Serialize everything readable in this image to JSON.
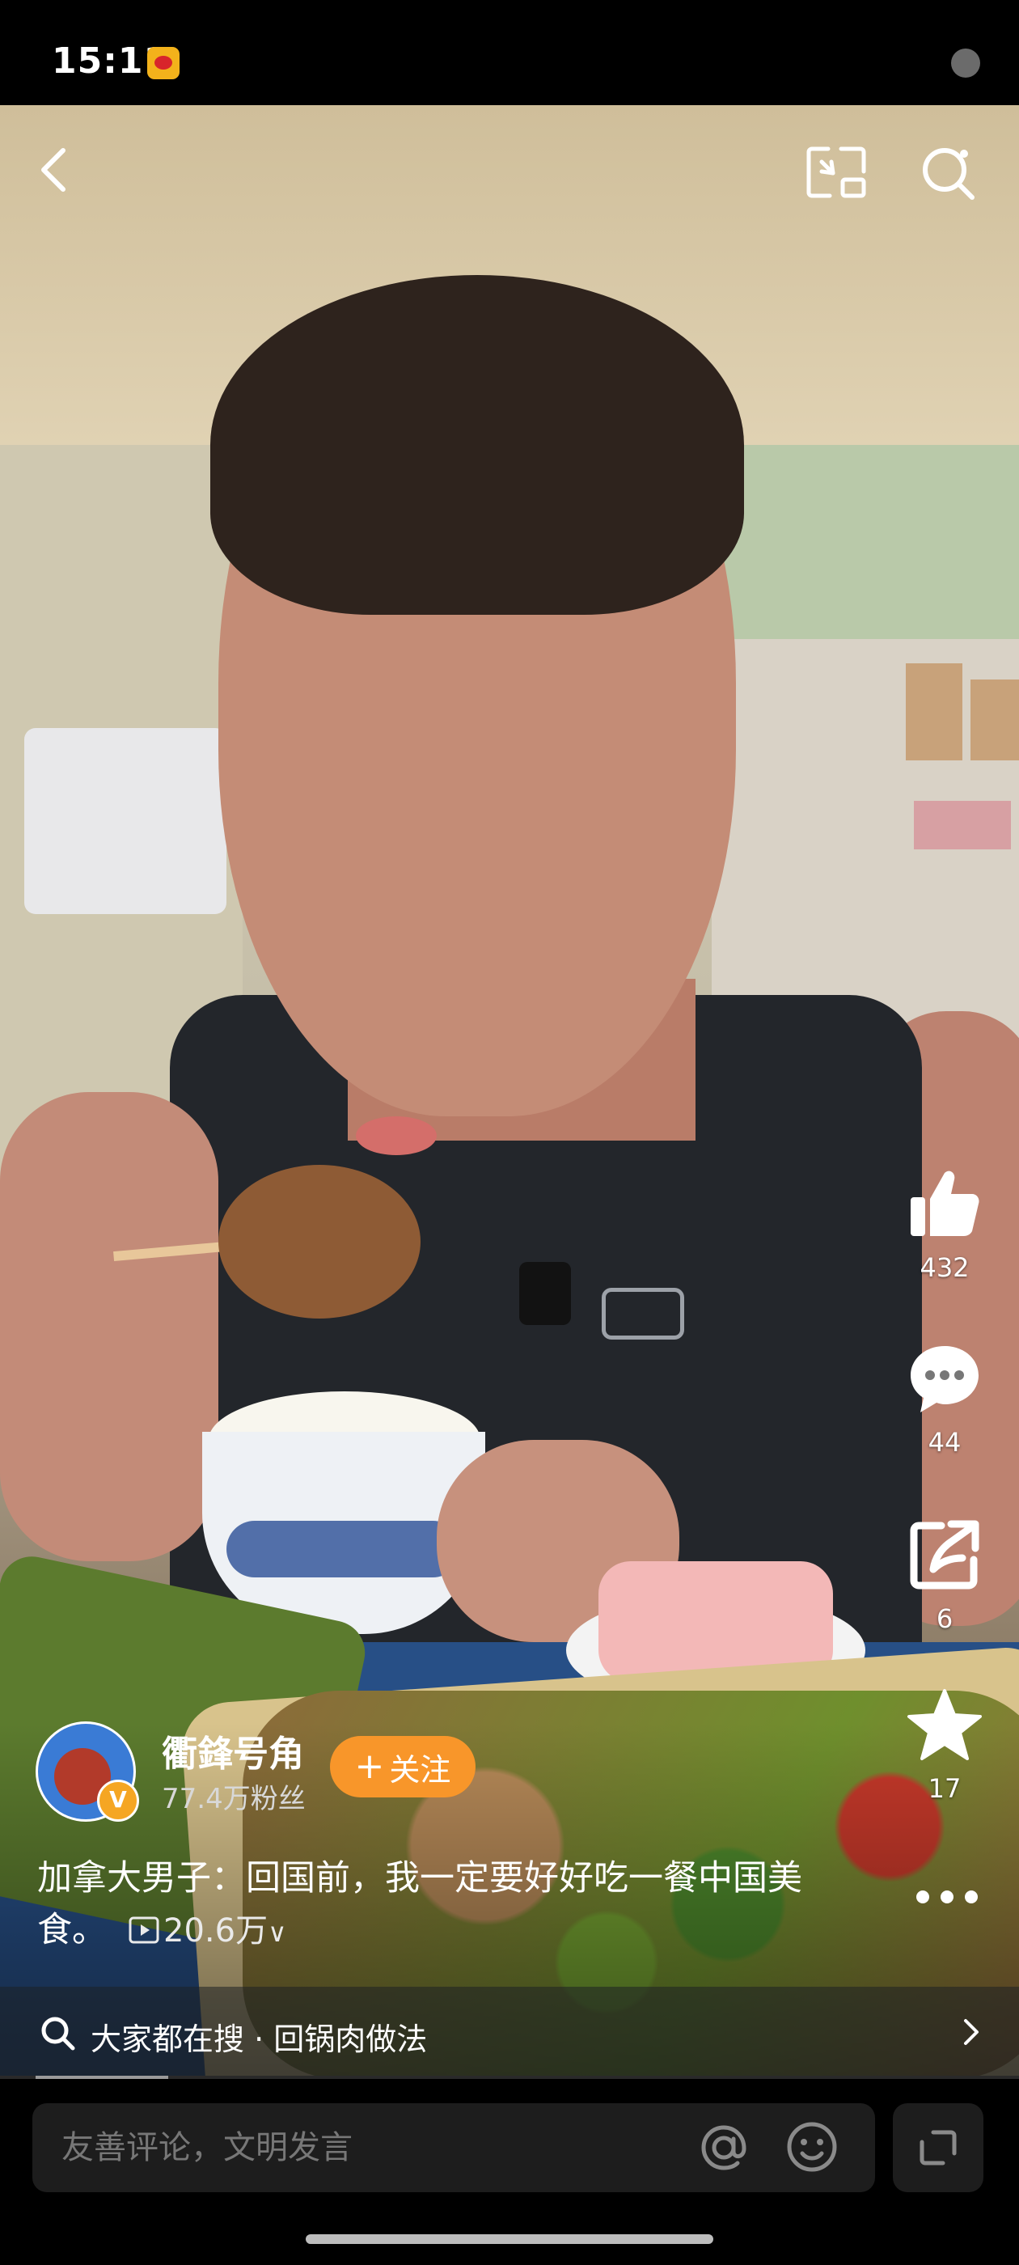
{
  "status_bar": {
    "time": "15:11"
  },
  "top_bar": {
    "back_icon": "chevron-left-icon",
    "pip_icon": "picture-in-picture-icon",
    "search_icon": "search-icon"
  },
  "actions": {
    "like": {
      "icon": "thumbs-up-icon",
      "count": "432"
    },
    "comment": {
      "icon": "comment-bubble-icon",
      "count": "44"
    },
    "share": {
      "icon": "share-icon",
      "count": "6"
    },
    "favorite": {
      "icon": "star-icon",
      "count": "17"
    },
    "more": {
      "icon": "more-dots-icon"
    }
  },
  "author": {
    "name": "衢鋒号角",
    "followers": "77.4万粉丝",
    "follow_label": "关注",
    "follow_plus": "+",
    "verified_mark": "V"
  },
  "post": {
    "caption": "加拿大男子：回国前，我一定要好好吃一餐中国美食。",
    "views": "20.6万",
    "views_chevron": "∨"
  },
  "hot_search": {
    "label": "大家都在搜 · 回锅肉做法"
  },
  "progress": {
    "fraction": 0.13
  },
  "comment_box": {
    "placeholder": "友善评论，文明发言"
  },
  "colors": {
    "follow_button": "#f8962a",
    "background": "#000000",
    "input_background": "#1d1d1d"
  }
}
